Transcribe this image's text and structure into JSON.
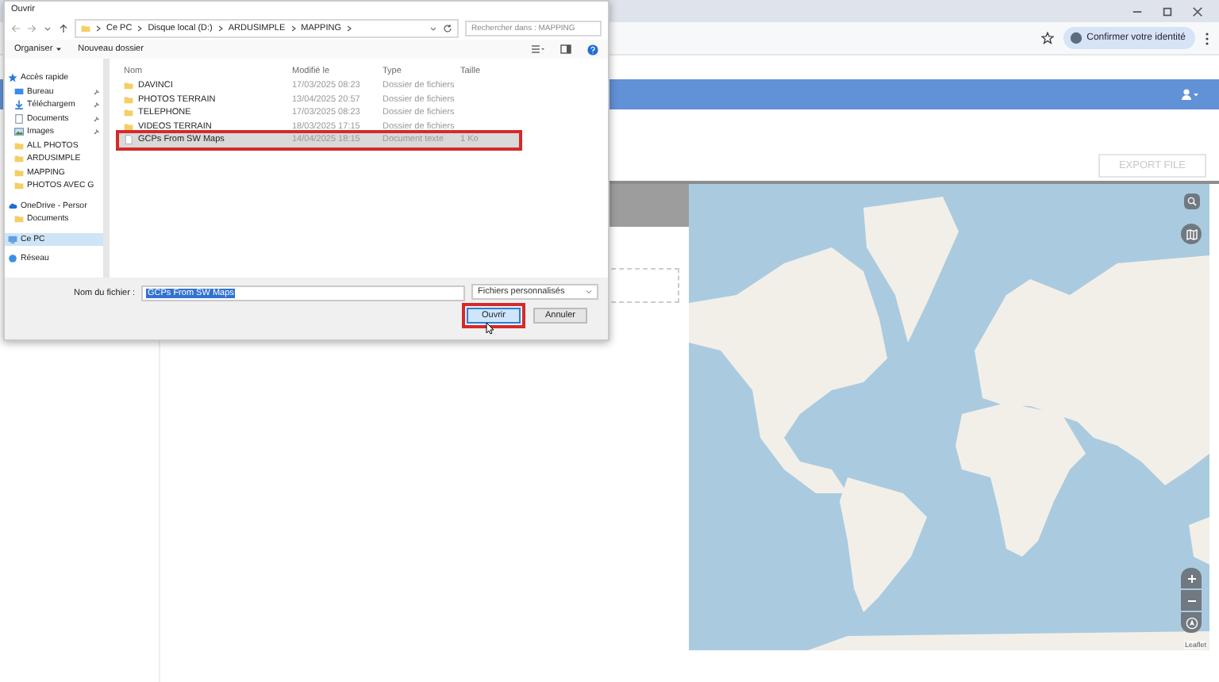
{
  "browser": {
    "identity_button": "Confirmer votre identité"
  },
  "app": {
    "export_button": "EXPORT FILE",
    "map": {
      "attribution": "Leaflet"
    }
  },
  "dialog": {
    "title": "Ouvrir",
    "breadcrumb": [
      "Ce PC",
      "Disque local (D:)",
      "ARDUSIMPLE",
      "MAPPING"
    ],
    "search": {
      "placeholder": "Rechercher dans : MAPPING"
    },
    "toolbar": {
      "organize": "Organiser",
      "new_folder": "Nouveau dossier"
    },
    "sidebar": [
      {
        "label": "Accès rapide",
        "kind": "star",
        "selected": false,
        "children": [
          {
            "label": "Bureau",
            "kind": "desktop",
            "pinned": true,
            "selected": false
          },
          {
            "label": "Téléchargem",
            "kind": "download",
            "pinned": true,
            "selected": false
          },
          {
            "label": "Documents",
            "kind": "document",
            "pinned": true,
            "selected": false
          },
          {
            "label": "Images",
            "kind": "image",
            "pinned": true,
            "selected": false
          },
          {
            "label": "ALL PHOTOS",
            "kind": "folder",
            "pinned": false,
            "selected": false
          },
          {
            "label": "ARDUSIMPLE",
            "kind": "folder",
            "pinned": false,
            "selected": false
          },
          {
            "label": "MAPPING",
            "kind": "folder",
            "pinned": false,
            "selected": false
          },
          {
            "label": "PHOTOS AVEC G",
            "kind": "folder",
            "pinned": false,
            "selected": false
          }
        ]
      },
      {
        "label": "OneDrive - Persor",
        "kind": "cloud",
        "selected": false,
        "children": [
          {
            "label": "Documents",
            "kind": "folder",
            "pinned": false,
            "selected": false
          }
        ]
      },
      {
        "label": "Ce PC",
        "kind": "pc",
        "selected": true
      },
      {
        "label": "Réseau",
        "kind": "network",
        "selected": false
      }
    ],
    "columns": [
      "Nom",
      "Modifié le",
      "Type",
      "Taille"
    ],
    "files": [
      {
        "name": "DAVINCI",
        "modified": "17/03/2025 08:23",
        "type": "Dossier de fichiers",
        "kind": "folder",
        "selected": false,
        "highlighted": false
      },
      {
        "name": "PHOTOS TERRAIN",
        "modified": "13/04/2025 20:57",
        "type": "Dossier de fichiers",
        "kind": "folder",
        "selected": false,
        "highlighted": false
      },
      {
        "name": "TELEPHONE",
        "modified": "17/03/2025 08:23",
        "type": "Dossier de fichiers",
        "kind": "folder",
        "selected": false,
        "highlighted": false
      },
      {
        "name": "VIDEOS TERRAIN",
        "modified": "18/03/2025 17:15",
        "type": "Dossier de fichiers",
        "kind": "folder",
        "selected": false,
        "highlighted": false
      },
      {
        "name": "GCPs From SW Maps",
        "modified": "14/04/2025 18:15",
        "type": "Document texte",
        "size": "1 Ko",
        "kind": "text",
        "selected": true,
        "highlighted": true
      }
    ],
    "filename_label": "Nom du fichier :",
    "filename_value": "GCPs From SW Maps",
    "filetype": "Fichiers personnalisés",
    "buttons": [
      {
        "label": "Ouvrir",
        "default": true,
        "highlighted": true
      },
      {
        "label": "Annuler",
        "default": false,
        "highlighted": false
      }
    ]
  }
}
